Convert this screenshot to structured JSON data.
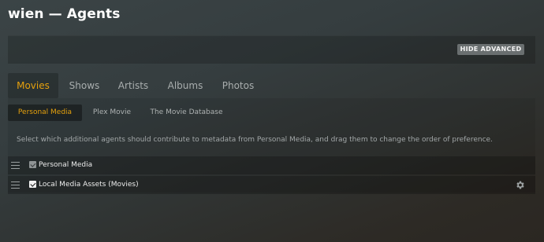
{
  "header": {
    "title": "wien — Agents"
  },
  "advanced": {
    "button_label": "HIDE ADVANCED"
  },
  "main_tabs": [
    {
      "label": "Movies",
      "active": true
    },
    {
      "label": "Shows",
      "active": false
    },
    {
      "label": "Artists",
      "active": false
    },
    {
      "label": "Albums",
      "active": false
    },
    {
      "label": "Photos",
      "active": false
    }
  ],
  "agent_tabs": [
    {
      "label": "Personal Media",
      "active": true
    },
    {
      "label": "Plex Movie",
      "active": false
    },
    {
      "label": "The Movie Database",
      "active": false
    }
  ],
  "description": "Select which additional agents should contribute to metadata from Personal Media, and drag them to change the order of preference.",
  "agents": [
    {
      "label": "Personal Media",
      "checked": true,
      "disabled": true,
      "has_settings": false
    },
    {
      "label": "Local Media Assets (Movies)",
      "checked": true,
      "disabled": false,
      "has_settings": true
    }
  ],
  "icons": {
    "drag": "drag-handle-icon",
    "settings": "gear-icon"
  },
  "colors": {
    "accent": "#e5a00d",
    "button_bg": "#6a6f70"
  }
}
